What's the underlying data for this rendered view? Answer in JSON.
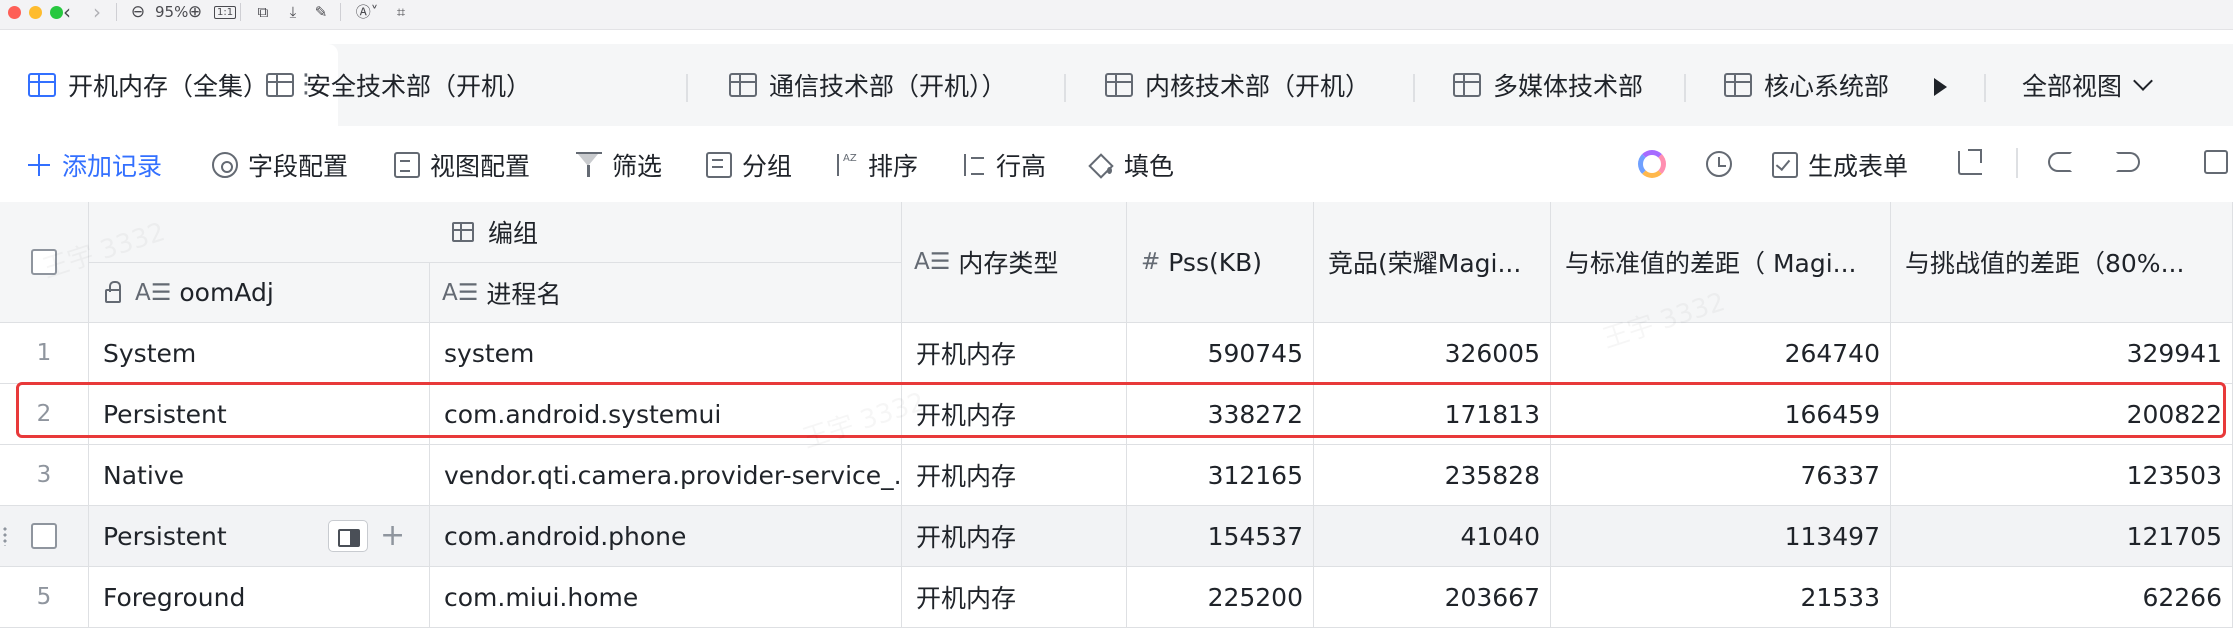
{
  "viewer_toolbar": {
    "zoom_level": "95%",
    "fit_label": "1:1"
  },
  "tabs": {
    "items": [
      {
        "label": "开机内存（全集）",
        "active": true
      },
      {
        "label": "安全技术部（开机）"
      },
      {
        "label": "通信技术部（开机））"
      },
      {
        "label": "内核技术部（开机）"
      },
      {
        "label": "多媒体技术部"
      },
      {
        "label": "核心系统部"
      }
    ],
    "more_symbol": "⋮",
    "all_views_label": "全部视图"
  },
  "toolbar": {
    "add_record": "添加记录",
    "field_config": "字段配置",
    "view_config": "视图配置",
    "filter": "筛选",
    "group": "分组",
    "sort": "排序",
    "row_height": "行高",
    "fill_color": "填色",
    "generate_form": "生成表单"
  },
  "table": {
    "group_header": "编组",
    "field_type_text_icon": "A☰",
    "field_type_number_icon": "#",
    "columns": {
      "oomadj": "oomAdj",
      "process": "进程名",
      "mem_type": "内存类型",
      "pss": "Pss(KB)",
      "competitor": "竞品(荣耀Magi...",
      "diff_standard": "与标准值的差距（ Magi...",
      "diff_challenge": "与挑战值的差距（80%..."
    },
    "rows": [
      {
        "index": "1",
        "oomadj": "System",
        "process": "system",
        "mem_type": "开机内存",
        "pss": "590745",
        "competitor": "326005",
        "diff_standard": "264740",
        "diff_challenge": "329941"
      },
      {
        "index": "2",
        "oomadj": "Persistent",
        "process": "com.android.systemui",
        "mem_type": "开机内存",
        "pss": "338272",
        "competitor": "171813",
        "diff_standard": "166459",
        "diff_challenge": "200822"
      },
      {
        "index": "3",
        "oomadj": "Native",
        "process": "vendor.qti.camera.provider-service_...",
        "mem_type": "开机内存",
        "pss": "312165",
        "competitor": "235828",
        "diff_standard": "76337",
        "diff_challenge": "123503"
      },
      {
        "index": "",
        "oomadj": "Persistent",
        "process": "com.android.phone",
        "mem_type": "开机内存",
        "pss": "154537",
        "competitor": "41040",
        "diff_standard": "113497",
        "diff_challenge": "121705"
      },
      {
        "index": "5",
        "oomadj": "Foreground",
        "process": "com.miui.home",
        "mem_type": "开机内存",
        "pss": "225200",
        "competitor": "203667",
        "diff_standard": "21533",
        "diff_challenge": "62266"
      }
    ]
  },
  "watermark": "王宇 3332"
}
